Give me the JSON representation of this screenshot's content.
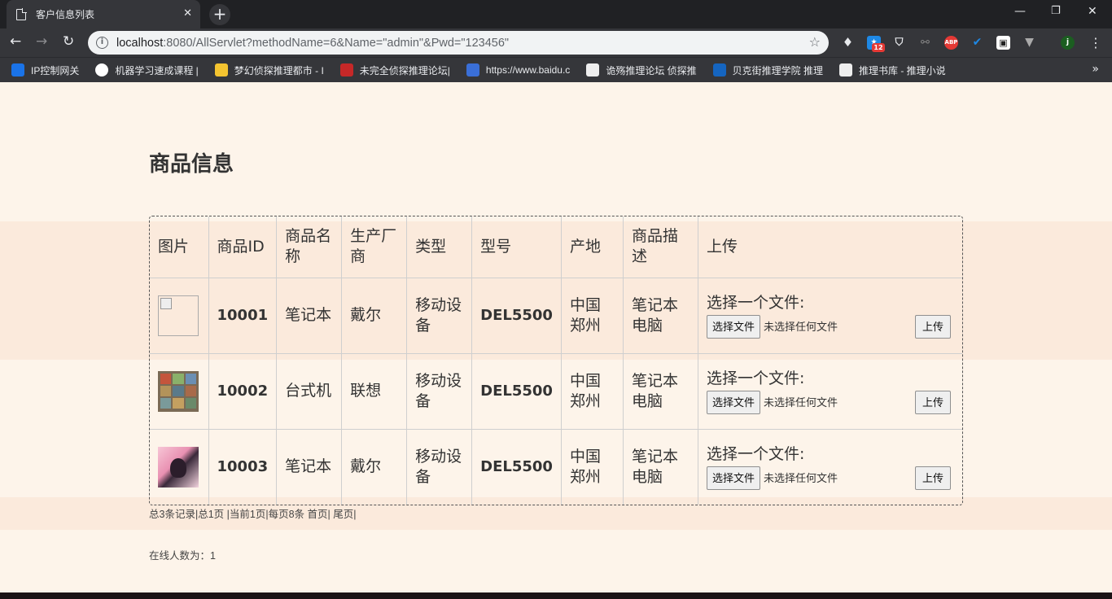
{
  "browser": {
    "tab_title": "客户信息列表",
    "tab_close": "✕",
    "new_tab": "+",
    "url_host": "localhost",
    "url_rest": ":8080/AllServlet?methodName=6&Name=\"admin\"&Pwd=\"123456\"",
    "extension_badge": "12",
    "abp_label": "ABP",
    "profile_initial": "j",
    "bookmarks": [
      {
        "label": "IP控制网关",
        "color": "#1a73e8"
      },
      {
        "label": "机器学习速成课程 |",
        "color": "#ffffff"
      },
      {
        "label": "梦幻侦探推理都市 - I",
        "color": "#f4c430"
      },
      {
        "label": "未完全侦探推理论坛|",
        "color": "#c62828"
      },
      {
        "label": "https://www.baidu.c",
        "color": "#3a6fd8"
      },
      {
        "label": "诡殇推理论坛 侦探推",
        "color": "#eeeeee"
      },
      {
        "label": "贝克街推理学院 推理",
        "color": "#1565c0"
      },
      {
        "label": "推理书库 - 推理小说",
        "color": "#eeeeee"
      }
    ],
    "bookmarks_more": "»"
  },
  "page": {
    "title": "商品信息",
    "columns": [
      "图片",
      "商品ID",
      "商品名称",
      "生产厂商",
      "类型",
      "型号",
      "产地",
      "商品描述",
      "上传"
    ],
    "rows": [
      {
        "image": "broken",
        "id": "10001",
        "name": "笔记本",
        "maker": "戴尔",
        "type": "移动设备",
        "model": "DEL5500",
        "origin": "中国郑州",
        "desc": "笔记本电脑"
      },
      {
        "image": "mosaic",
        "id": "10002",
        "name": "台式机",
        "maker": "联想",
        "type": "移动设备",
        "model": "DEL5500",
        "origin": "中国郑州",
        "desc": "笔记本电脑"
      },
      {
        "image": "portrait",
        "id": "10003",
        "name": "笔记本",
        "maker": "戴尔",
        "type": "移动设备",
        "model": "DEL5500",
        "origin": "中国郑州",
        "desc": "笔记本电脑"
      }
    ],
    "upload": {
      "label": "选择一个文件:",
      "choose_button": "选择文件",
      "no_file": "未选择任何文件",
      "submit": "上传"
    },
    "pager": "总3条记录|总1页 |当前1页|每页8条 首页| 尾页|",
    "online": "在线人数为：1"
  }
}
